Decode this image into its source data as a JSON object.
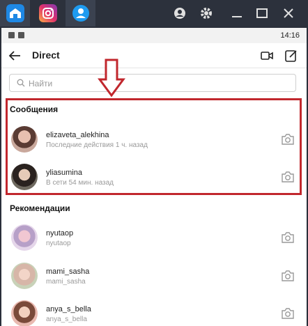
{
  "emulator": {
    "tabs": [
      "home-tab",
      "instagram-tab",
      "profile-tab"
    ],
    "icons": [
      "account-icon",
      "gear-icon",
      "minimize-icon",
      "maximize-icon",
      "close-icon"
    ]
  },
  "statusbar": {
    "time": "14:16"
  },
  "header": {
    "title": "Direct"
  },
  "search": {
    "placeholder": "Найти"
  },
  "messages": {
    "title": "Сообщения",
    "items": [
      {
        "username": "elizaveta_alekhina",
        "status": "Последние действия 1 ч. назад"
      },
      {
        "username": "yliasumina",
        "status": "В сети 54 мин. назад"
      }
    ]
  },
  "recommendations": {
    "title": "Рекомендации",
    "items": [
      {
        "username": "nyutaop",
        "subtitle": "nyutaop"
      },
      {
        "username": "mami_sasha",
        "subtitle": "mami_sasha"
      },
      {
        "username": "anya_s_bella",
        "subtitle": "anya_s_bella"
      }
    ]
  },
  "colors": {
    "highlight": "#c1272d",
    "accent_blue": "#2f80ed"
  }
}
